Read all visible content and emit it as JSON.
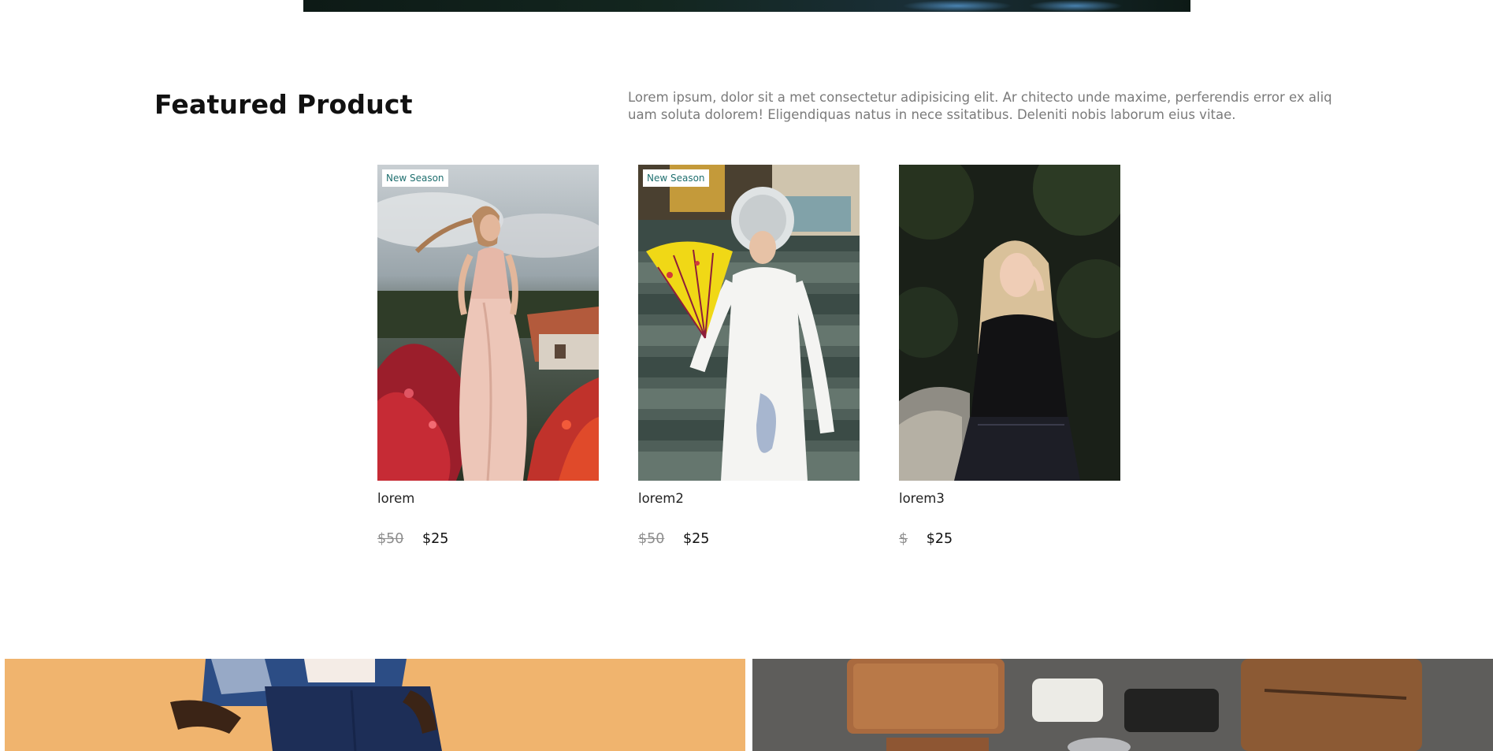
{
  "featured": {
    "title": "Featured Product",
    "description": "Lorem ipsum, dolor sit a met consectetur adipisicing elit. Ar chitecto unde maxime, perferendis error ex aliq uam soluta dolorem! Eligendiquas natus in nece ssitatibus. Deleniti nobis laborum eius vitae."
  },
  "products": [
    {
      "badge": "New Season",
      "name": "lorem",
      "old_price": "$50",
      "price": "$25",
      "image_icon": "woman-pink-dress-flowers-photo"
    },
    {
      "badge": "New Season",
      "name": "lorem2",
      "old_price": "$50",
      "price": "$25",
      "image_icon": "woman-white-ao-dai-fan-photo"
    },
    {
      "badge": "",
      "name": "lorem3",
      "old_price": "$",
      "price": "$25",
      "image_icon": "woman-black-blouse-photo"
    }
  ],
  "banners": [
    {
      "image_icon": "man-navy-trousers-photo"
    },
    {
      "image_icon": "leather-accessories-flatlay-photo"
    }
  ],
  "colors": {
    "badge_text": "#1f6f6f",
    "old_price": "#8d8d8d",
    "description": "#7a7a7a"
  }
}
